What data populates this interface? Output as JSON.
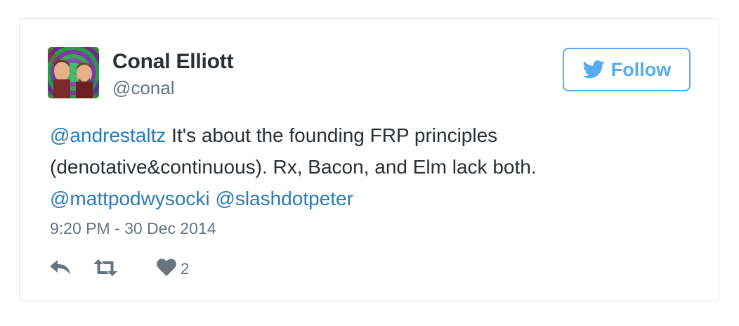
{
  "author": {
    "name": "Conal Elliott",
    "handle": "@conal"
  },
  "follow_label": "Follow",
  "tweet": {
    "mention_1": "@andrestaltz",
    "text_1": " It's about the founding FRP principles",
    "text_2": "(denotative&continuous). Rx, Bacon, and Elm lack both.",
    "mention_2": "@mattpodwysocki",
    "mention_3": "@slashdotpeter"
  },
  "timestamp": "9:20 PM - 30 Dec 2014",
  "actions": {
    "like_count": "2"
  },
  "colors": {
    "accent": "#55acee",
    "mention": "#2b7bb9",
    "text": "#292f33",
    "muted": "#66757f",
    "border": "#e1e8ed"
  },
  "icons": [
    "twitter-bird-icon",
    "reply-icon",
    "retweet-icon",
    "heart-icon"
  ]
}
